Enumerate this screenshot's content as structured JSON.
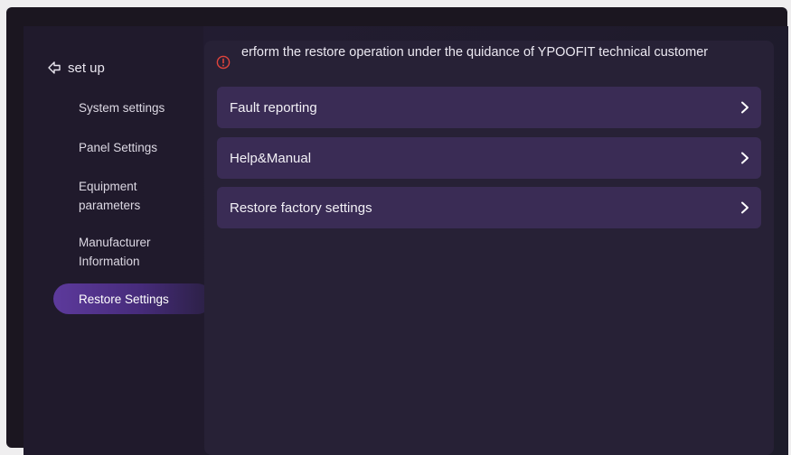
{
  "sidebar": {
    "back_label": "set up",
    "items": [
      {
        "label": "System settings"
      },
      {
        "label": "Panel Settings"
      },
      {
        "label": "Equipment parameters"
      },
      {
        "label": "Manufacturer Information"
      },
      {
        "label": "Restore Settings",
        "active": true
      }
    ]
  },
  "main": {
    "warning_text": "erform the restore operation under the quidance of YPOOFIT technical customer",
    "rows": [
      {
        "label": "Fault reporting",
        "icon": "chevron-right-icon"
      },
      {
        "label": "Help&Manual",
        "icon": "chevron-right-icon"
      },
      {
        "label": "Restore factory settings",
        "icon": "chevron-right-icon"
      }
    ]
  },
  "colors": {
    "accent": "#5d3a9c",
    "warning": "#e0443c",
    "row_bg": "#3a2c55",
    "panel_bg": "#272136"
  }
}
